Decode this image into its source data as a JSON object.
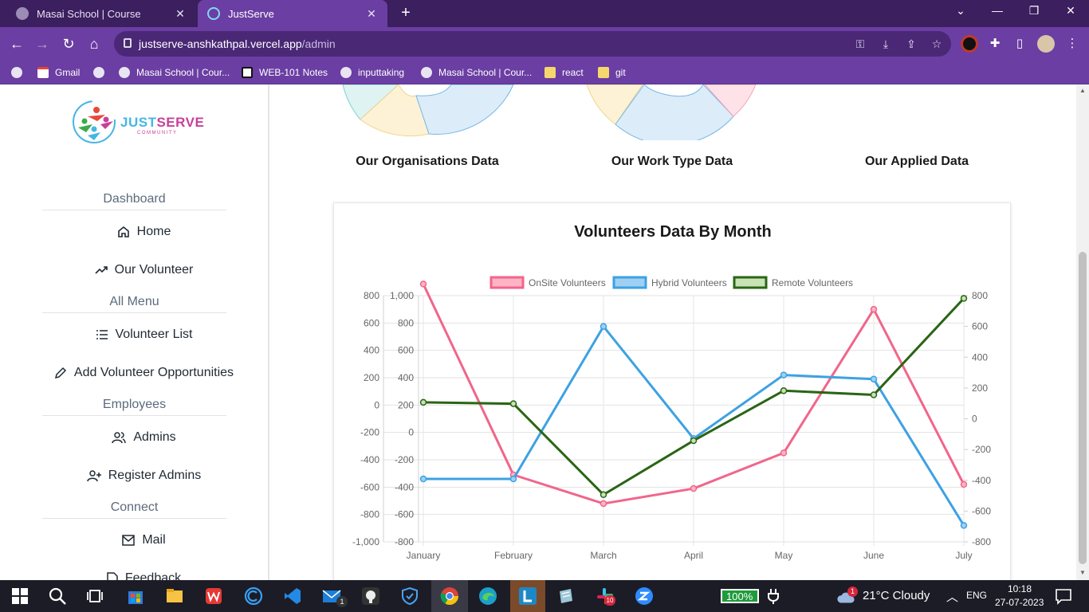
{
  "browser": {
    "tabs": [
      {
        "title": "Masai School | Course",
        "active": false
      },
      {
        "title": "JustServe",
        "active": true
      }
    ],
    "url": {
      "host": "justserve-anshkathpal.vercel.app",
      "path": "/admin"
    },
    "bookmarks": [
      "Gmail",
      "Masai School | Cour...",
      "WEB-101 Notes",
      "inputtaking",
      "Masai School | Cour...",
      "react",
      "git"
    ]
  },
  "sidebar": {
    "logo": {
      "just": "JUST",
      "serve": "SERVE",
      "sub": "COMMUNITY"
    },
    "sections": [
      {
        "heading": "Dashboard",
        "items": [
          "Home",
          "Our Volunteer"
        ]
      },
      {
        "heading": "All Menu",
        "items": [
          "Volunteer List",
          "Add Volunteer Opportunities"
        ]
      },
      {
        "heading": "Employees",
        "items": [
          "Admins",
          "Register Admins"
        ]
      },
      {
        "heading": "Connect",
        "items": [
          "Mail",
          "Feedback"
        ]
      }
    ]
  },
  "donuts": [
    {
      "label": "Our Organisations Data"
    },
    {
      "label": "Our Work Type Data"
    },
    {
      "label": "Our Applied Data"
    }
  ],
  "colors": {
    "onsite": "#f0668a",
    "hybrid": "#3da1e3",
    "remote": "#2a6515",
    "browser_dark": "#3b1f5e",
    "browser_accent": "#6b3ea3"
  },
  "chart_data": {
    "type": "line",
    "title": "Volunteers Data By Month",
    "categories": [
      "January",
      "February",
      "March",
      "April",
      "May",
      "June",
      "July"
    ],
    "series": [
      {
        "name": "OnSite Volunteers",
        "axis": "y",
        "values": [
          885,
          -510,
          -720,
          -610,
          -350,
          700,
          -580
        ]
      },
      {
        "name": "Hybrid Volunteers",
        "axis": "y1",
        "values": [
          -340,
          -340,
          775,
          -45,
          420,
          390,
          -680
        ]
      },
      {
        "name": "Remote Volunteers",
        "axis": "y",
        "values": [
          20,
          10,
          -655,
          -260,
          105,
          75,
          780
        ]
      }
    ],
    "y_axis_primary": {
      "ticks": [
        "800",
        "600",
        "400",
        "200",
        "0",
        "-200",
        "-400",
        "-600",
        "-800",
        "-1,000"
      ],
      "ylim": [
        -1000,
        800
      ]
    },
    "y_axis_secondary_inner": {
      "ticks": [
        "1,000",
        "800",
        "600",
        "400",
        "200",
        "0",
        "-200",
        "-400",
        "-600",
        "-800"
      ],
      "ylim": [
        -800,
        1000
      ]
    },
    "y_axis_right": {
      "ticks": [
        "800",
        "600",
        "400",
        "200",
        "0",
        "-200",
        "-400",
        "-600",
        "-800"
      ],
      "ylim": [
        -800,
        800
      ]
    },
    "legend": "top",
    "grid": true
  },
  "taskbar": {
    "battery": "100%",
    "weather": "21°C  Cloudy",
    "weather_badge": "1",
    "lang": "ENG",
    "time": "10:18",
    "date": "27-07-2023",
    "mail_badge": "1",
    "chrome_badge": "10"
  }
}
